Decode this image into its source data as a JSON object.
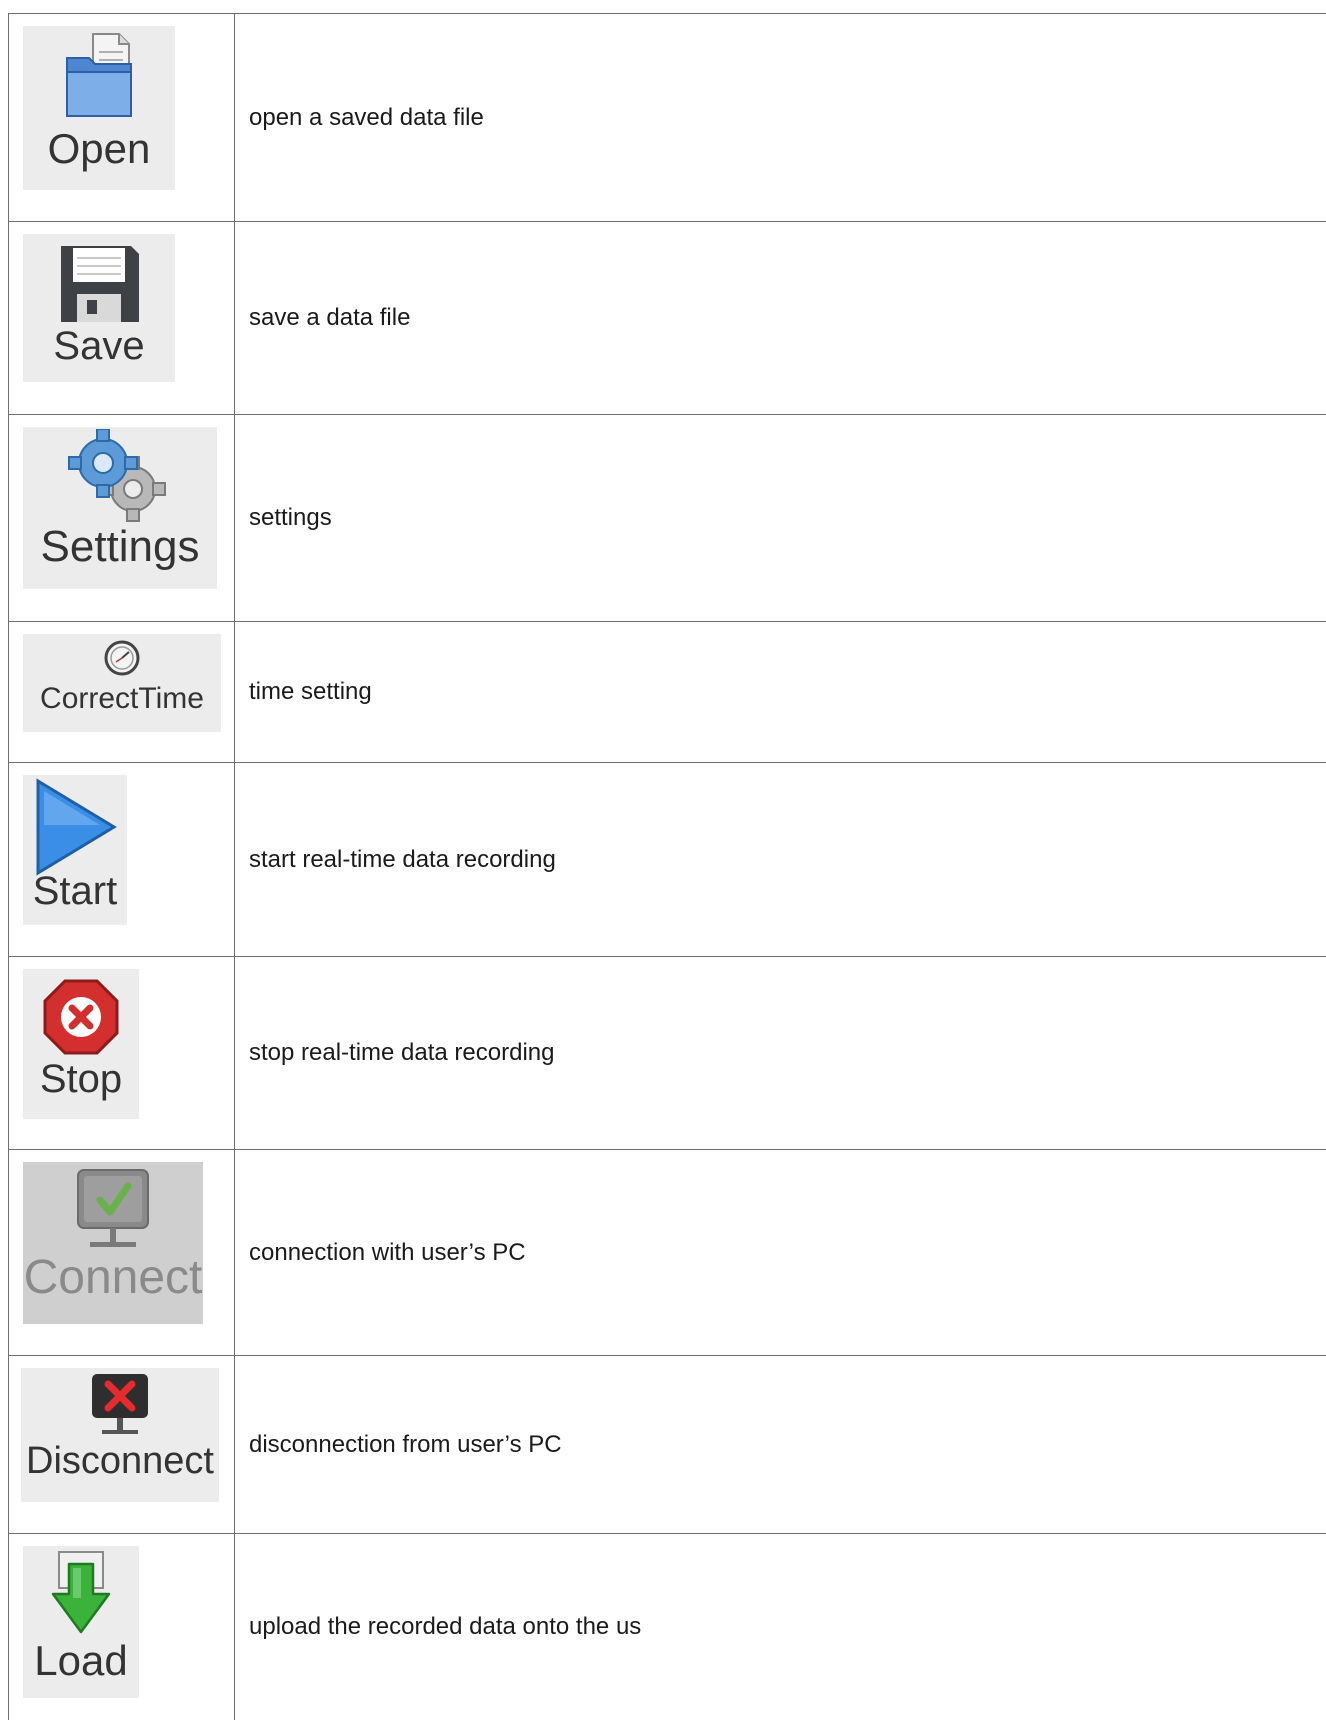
{
  "rows": [
    {
      "label": "Open",
      "icon": "folder-icon",
      "description": "open a saved data file"
    },
    {
      "label": "Save",
      "icon": "floppy-disk-icon",
      "description": "save a data file"
    },
    {
      "label": "Settings",
      "icon": "gears-icon",
      "description": "settings"
    },
    {
      "label": "CorrectTime",
      "icon": "clock-icon",
      "description": "time setting"
    },
    {
      "label": "Start",
      "icon": "play-triangle-icon",
      "description": "start real-time data recording"
    },
    {
      "label": "Stop",
      "icon": "stop-x-icon",
      "description": "stop real-time data recording"
    },
    {
      "label": "Connect",
      "icon": "monitor-check-icon",
      "description": "connection with user’s PC"
    },
    {
      "label": "Disconnect",
      "icon": "monitor-x-icon",
      "description": "disconnection from user’s PC"
    },
    {
      "label": "Load",
      "icon": "down-arrow-icon",
      "description": "upload the recorded data onto the us"
    }
  ],
  "colors": {
    "folder_blue": "#5b8fd6",
    "play_blue": "#3a8ee6",
    "stop_red": "#d32f2f",
    "check_green": "#6ab04c",
    "arrow_green": "#3bb33b"
  }
}
